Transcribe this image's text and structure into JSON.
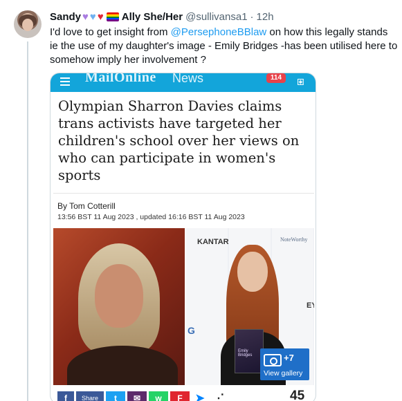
{
  "tweet": {
    "author_name": "Sandy",
    "author_suffix": "Ally She/Her",
    "handle": "@sullivansa1",
    "separator": "·",
    "time": "12h",
    "text_line1_prefix": "I'd love to get insight from ",
    "mention": "@PersephoneBBlaw",
    "text_line1_suffix": " on how this legally stands",
    "text_line2": "ie the use of my daughter's image - Emily Bridges -has been utilised here to",
    "text_line3": "somehow imply her involvement ?",
    "emojis": [
      "purple-heart",
      "blue-heart",
      "red-heart",
      "rainbow-flag"
    ],
    "flag_colors": [
      "#e40303",
      "#ff8c00",
      "#ffed00",
      "#008026",
      "#004dff",
      "#750787"
    ]
  },
  "card": {
    "site_brand": "MailOnline",
    "site_section": "News",
    "notification_count": "114",
    "headline": "Olympian Sharron Davies claims trans activists have targeted her children's school over her views on who can participate in women's sports",
    "byline": "By Tom Cotterill",
    "dateline": "13:56 BST 11 Aug 2023 , updated 16:16 BST 11 Aug 2023",
    "photo_right_text": {
      "kantar": "KANTAR",
      "noteworthy": "NoteWorthy",
      "ey": "EY",
      "g": "G",
      "award_name": "Emily Bridges"
    },
    "gallery": {
      "count": "+7",
      "label": "View gallery"
    },
    "share": {
      "facebook": "f",
      "share_label": "Share",
      "twitter": "t",
      "email": "✉",
      "whatsapp": "w",
      "flipboard": "F",
      "messenger": "➤",
      "more": "⋰",
      "count": "45"
    },
    "brand_color": "#13a5da"
  }
}
